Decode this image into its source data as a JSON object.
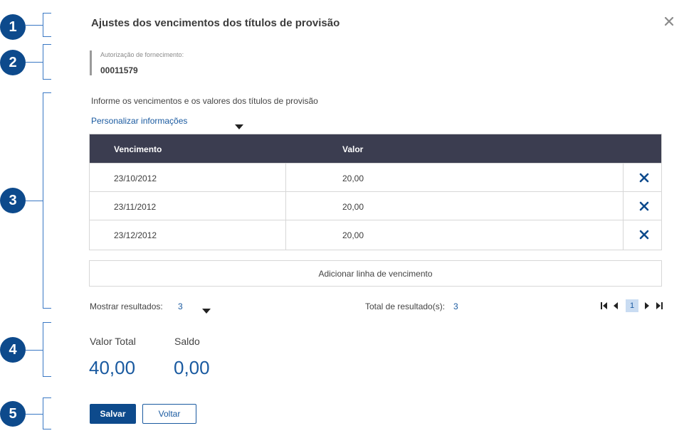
{
  "callouts": [
    "1",
    "2",
    "3",
    "4",
    "5"
  ],
  "dialog": {
    "title": "Ajustes dos vencimentos dos títulos de provisão",
    "close_icon": "close-icon"
  },
  "authorization": {
    "label": "Autorização de fornecimento:",
    "value": "00011579"
  },
  "section": {
    "instructions": "Informe os vencimentos e os valores dos títulos de provisão",
    "personalize": "Personalizar informações"
  },
  "table": {
    "headers": [
      "Vencimento",
      "Valor"
    ],
    "rows": [
      {
        "vencimento": "23/10/2012",
        "valor": "20,00"
      },
      {
        "vencimento": "23/11/2012",
        "valor": "20,00"
      },
      {
        "vencimento": "23/12/2012",
        "valor": "20,00"
      }
    ],
    "delete_icon": "close-icon"
  },
  "add_line": "Adicionar linha de vencimento",
  "pagination": {
    "show_label": "Mostrar resultados:",
    "show_value": "3",
    "total_label": "Total de resultado(s):",
    "total_value": "3",
    "current_page": "1"
  },
  "summary": {
    "total_label": "Valor Total",
    "total_value": "40,00",
    "balance_label": "Saldo",
    "balance_value": "0,00"
  },
  "actions": {
    "save": "Salvar",
    "back": "Voltar"
  },
  "colors": {
    "primary": "#0d4a8c",
    "link": "#1a5aa0",
    "table_header": "#3b3d50"
  }
}
